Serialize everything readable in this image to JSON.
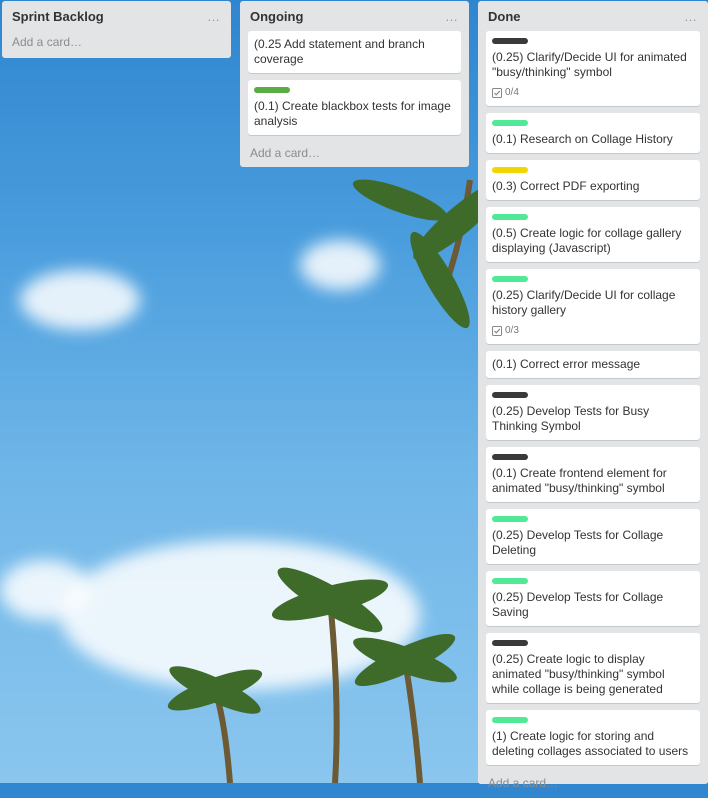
{
  "lists": [
    {
      "title": "Sprint Backlog",
      "menu": "…",
      "add_card": "Add a card…",
      "cards": []
    },
    {
      "title": "Ongoing",
      "menu": "…",
      "add_card": "Add a card…",
      "cards": [
        {
          "text": "(0.25 Add statement and branch coverage"
        },
        {
          "text": "(0.1) Create blackbox tests for image analysis",
          "label_color": "#5aac44"
        }
      ]
    },
    {
      "title": "Done",
      "menu": "…",
      "add_card": "Add a card…",
      "cards": [
        {
          "text": "(0.25) Clarify/Decide UI for animated \"busy/thinking\" symbol",
          "label_color": "#3a3a3a",
          "checklist": "0/4"
        },
        {
          "text": "(0.1) Research on Collage History",
          "label_color": "#51e898"
        },
        {
          "text": "(0.3) Correct PDF exporting",
          "label_color": "#f2d600"
        },
        {
          "text": "(0.5) Create logic for collage gallery displaying (Javascript)",
          "label_color": "#51e898"
        },
        {
          "text": "(0.25) Clarify/Decide UI for collage history gallery",
          "label_color": "#51e898",
          "checklist": "0/3"
        },
        {
          "text": "(0.1) Correct error message"
        },
        {
          "text": "(0.25) Develop Tests for Busy Thinking Symbol",
          "label_color": "#3a3a3a"
        },
        {
          "text": "(0.1) Create frontend element for animated \"busy/thinking\" symbol",
          "label_color": "#3a3a3a"
        },
        {
          "text": "(0.25) Develop Tests for Collage Deleting",
          "label_color": "#51e898"
        },
        {
          "text": "(0.25) Develop Tests for Collage Saving",
          "label_color": "#51e898"
        },
        {
          "text": "(0.25) Create logic to display animated \"busy/thinking\" symbol while collage is being generated",
          "label_color": "#3a3a3a"
        },
        {
          "text": "(1) Create logic for storing and deleting collages associated to users",
          "label_color": "#51e898"
        }
      ]
    }
  ]
}
